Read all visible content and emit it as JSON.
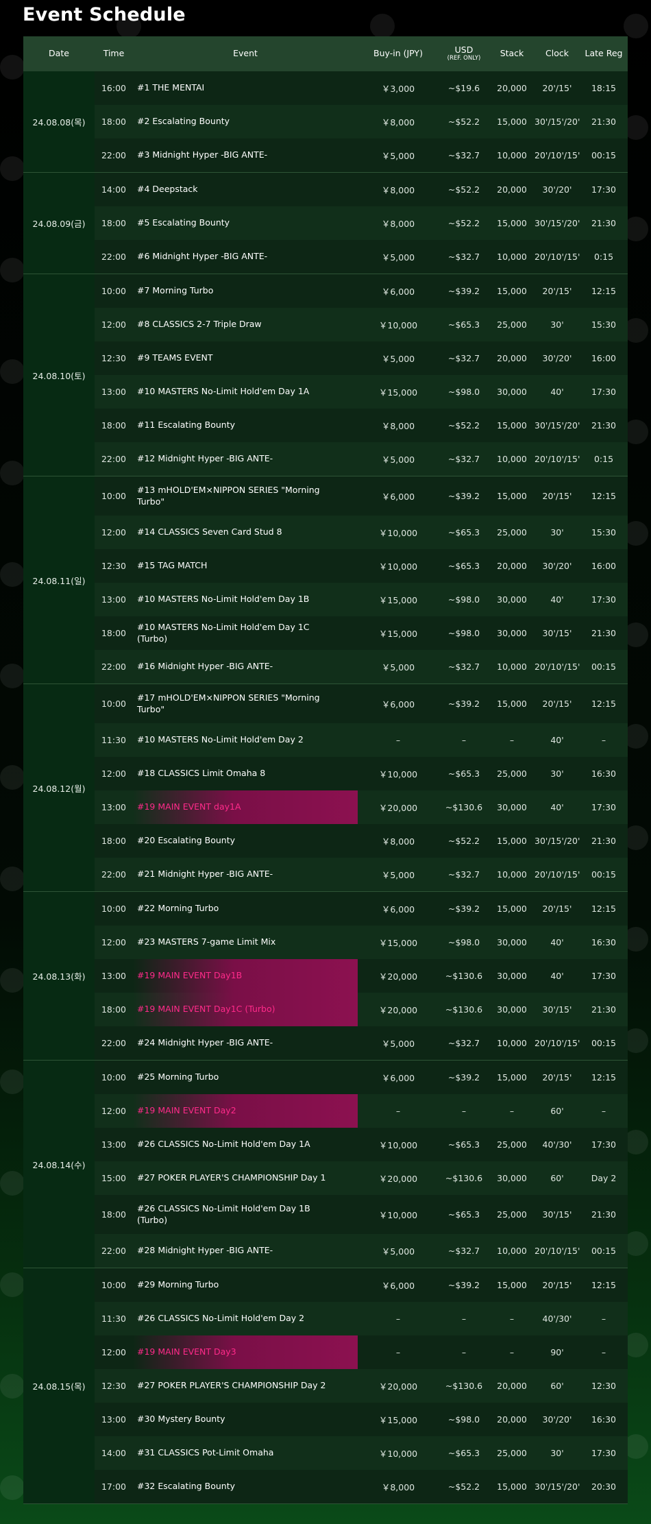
{
  "page_title": "Event Schedule",
  "columns": {
    "date": "Date",
    "time": "Time",
    "event": "Event",
    "buyin": "Buy-in (JPY)",
    "usd": "USD",
    "usd_note": "(REF. ONLY)",
    "stack": "Stack",
    "clock": "Clock",
    "late_reg": "Late Reg"
  },
  "days": [
    {
      "date": "24.08.08(목)",
      "events": [
        {
          "time": "16:00",
          "event": "#1 THE MENTAI",
          "buyin": "￥3,000",
          "usd": "~$19.6",
          "stack": "20,000",
          "clock": "20'/15'",
          "late": "18:15",
          "main": false,
          "tall": false
        },
        {
          "time": "18:00",
          "event": "#2 Escalating Bounty",
          "buyin": "￥8,000",
          "usd": "~$52.2",
          "stack": "15,000",
          "clock": "30'/15'/20'",
          "late": "21:30",
          "main": false,
          "tall": false
        },
        {
          "time": "22:00",
          "event": "#3 Midnight Hyper -BIG ANTE-",
          "buyin": "￥5,000",
          "usd": "~$32.7",
          "stack": "10,000",
          "clock": "20'/10'/15'",
          "late": "00:15",
          "main": false,
          "tall": false
        }
      ]
    },
    {
      "date": "24.08.09(금)",
      "events": [
        {
          "time": "14:00",
          "event": "#4 Deepstack",
          "buyin": "￥8,000",
          "usd": "~$52.2",
          "stack": "20,000",
          "clock": "30'/20'",
          "late": "17:30",
          "main": false,
          "tall": false
        },
        {
          "time": "18:00",
          "event": "#5 Escalating Bounty",
          "buyin": "￥8,000",
          "usd": "~$52.2",
          "stack": "15,000",
          "clock": "30'/15'/20'",
          "late": "21:30",
          "main": false,
          "tall": false
        },
        {
          "time": "22:00",
          "event": "#6 Midnight Hyper -BIG ANTE-",
          "buyin": "￥5,000",
          "usd": "~$32.7",
          "stack": "10,000",
          "clock": "20'/10'/15'",
          "late": "0:15",
          "main": false,
          "tall": false
        }
      ]
    },
    {
      "date": "24.08.10(토)",
      "events": [
        {
          "time": "10:00",
          "event": "#7 Morning Turbo",
          "buyin": "￥6,000",
          "usd": "~$39.2",
          "stack": "15,000",
          "clock": "20'/15'",
          "late": "12:15",
          "main": false,
          "tall": false
        },
        {
          "time": "12:00",
          "event": "#8 CLASSICS 2-7 Triple Draw",
          "buyin": "￥10,000",
          "usd": "~$65.3",
          "stack": "25,000",
          "clock": "30'",
          "late": "15:30",
          "main": false,
          "tall": false
        },
        {
          "time": "12:30",
          "event": "#9 TEAMS EVENT",
          "buyin": "￥5,000",
          "usd": "~$32.7",
          "stack": "20,000",
          "clock": "30'/20'",
          "late": "16:00",
          "main": false,
          "tall": false
        },
        {
          "time": "13:00",
          "event": "#10 MASTERS No-Limit Hold'em Day 1A",
          "buyin": "￥15,000",
          "usd": "~$98.0",
          "stack": "30,000",
          "clock": "40'",
          "late": "17:30",
          "main": false,
          "tall": false
        },
        {
          "time": "18:00",
          "event": "#11 Escalating Bounty",
          "buyin": "￥8,000",
          "usd": "~$52.2",
          "stack": "15,000",
          "clock": "30'/15'/20'",
          "late": "21:30",
          "main": false,
          "tall": false
        },
        {
          "time": "22:00",
          "event": "#12 Midnight Hyper -BIG ANTE-",
          "buyin": "￥5,000",
          "usd": "~$32.7",
          "stack": "10,000",
          "clock": "20'/10'/15'",
          "late": "0:15",
          "main": false,
          "tall": false
        }
      ]
    },
    {
      "date": "24.08.11(일)",
      "events": [
        {
          "time": "10:00",
          "event": "#13 mHOLD'EM×NIPPON SERIES \"Morning Turbo\"",
          "buyin": "￥6,000",
          "usd": "~$39.2",
          "stack": "15,000",
          "clock": "20'/15'",
          "late": "12:15",
          "main": false,
          "tall": true
        },
        {
          "time": "12:00",
          "event": "#14 CLASSICS Seven Card Stud 8",
          "buyin": "￥10,000",
          "usd": "~$65.3",
          "stack": "25,000",
          "clock": "30'",
          "late": "15:30",
          "main": false,
          "tall": false
        },
        {
          "time": "12:30",
          "event": "#15 TAG MATCH",
          "buyin": "￥10,000",
          "usd": "~$65.3",
          "stack": "20,000",
          "clock": "30'/20'",
          "late": "16:00",
          "main": false,
          "tall": false
        },
        {
          "time": "13:00",
          "event": "#10 MASTERS No-Limit Hold'em Day 1B",
          "buyin": "￥15,000",
          "usd": "~$98.0",
          "stack": "30,000",
          "clock": "40'",
          "late": "17:30",
          "main": false,
          "tall": false
        },
        {
          "time": "18:00",
          "event": "#10 MASTERS No-Limit Hold'em Day 1C (Turbo)",
          "buyin": "￥15,000",
          "usd": "~$98.0",
          "stack": "30,000",
          "clock": "30'/15'",
          "late": "21:30",
          "main": false,
          "tall": false
        },
        {
          "time": "22:00",
          "event": "#16 Midnight Hyper -BIG ANTE-",
          "buyin": "￥5,000",
          "usd": "~$32.7",
          "stack": "10,000",
          "clock": "20'/10'/15'",
          "late": "00:15",
          "main": false,
          "tall": false
        }
      ]
    },
    {
      "date": "24.08.12(월)",
      "events": [
        {
          "time": "10:00",
          "event": "#17 mHOLD'EM×NIPPON SERIES \"Morning Turbo\"",
          "buyin": "￥6,000",
          "usd": "~$39.2",
          "stack": "15,000",
          "clock": "20'/15'",
          "late": "12:15",
          "main": false,
          "tall": true
        },
        {
          "time": "11:30",
          "event": "#10 MASTERS No-Limit Hold'em Day 2",
          "buyin": "–",
          "usd": "–",
          "stack": "–",
          "clock": "40'",
          "late": "–",
          "main": false,
          "tall": false
        },
        {
          "time": "12:00",
          "event": "#18 CLASSICS Limit Omaha 8",
          "buyin": "￥10,000",
          "usd": "~$65.3",
          "stack": "25,000",
          "clock": "30'",
          "late": "16:30",
          "main": false,
          "tall": false
        },
        {
          "time": "13:00",
          "event": "#19 MAIN EVENT day1A",
          "buyin": "￥20,000",
          "usd": "~$130.6",
          "stack": "30,000",
          "clock": "40'",
          "late": "17:30",
          "main": true,
          "tall": false
        },
        {
          "time": "18:00",
          "event": "#20 Escalating Bounty",
          "buyin": "￥8,000",
          "usd": "~$52.2",
          "stack": "15,000",
          "clock": "30'/15'/20'",
          "late": "21:30",
          "main": false,
          "tall": false
        },
        {
          "time": "22:00",
          "event": "#21 Midnight Hyper -BIG ANTE-",
          "buyin": "￥5,000",
          "usd": "~$32.7",
          "stack": "10,000",
          "clock": "20'/10'/15'",
          "late": "00:15",
          "main": false,
          "tall": false
        }
      ]
    },
    {
      "date": "24.08.13(화)",
      "events": [
        {
          "time": "10:00",
          "event": "#22 Morning Turbo",
          "buyin": "￥6,000",
          "usd": "~$39.2",
          "stack": "15,000",
          "clock": "20'/15'",
          "late": "12:15",
          "main": false,
          "tall": false
        },
        {
          "time": "12:00",
          "event": "#23 MASTERS 7-game Limit Mix",
          "buyin": "￥15,000",
          "usd": "~$98.0",
          "stack": "30,000",
          "clock": "40'",
          "late": "16:30",
          "main": false,
          "tall": false
        },
        {
          "time": "13:00",
          "event": "#19 MAIN EVENT Day1B",
          "buyin": "￥20,000",
          "usd": "~$130.6",
          "stack": "30,000",
          "clock": "40'",
          "late": "17:30",
          "main": true,
          "tall": false
        },
        {
          "time": "18:00",
          "event": "#19 MAIN EVENT Day1C (Turbo)",
          "buyin": "￥20,000",
          "usd": "~$130.6",
          "stack": "30,000",
          "clock": "30'/15'",
          "late": "21:30",
          "main": true,
          "tall": false
        },
        {
          "time": "22:00",
          "event": "#24 Midnight Hyper -BIG ANTE-",
          "buyin": "￥5,000",
          "usd": "~$32.7",
          "stack": "10,000",
          "clock": "20'/10'/15'",
          "late": "00:15",
          "main": false,
          "tall": false
        }
      ]
    },
    {
      "date": "24.08.14(수)",
      "events": [
        {
          "time": "10:00",
          "event": "#25 Morning Turbo",
          "buyin": "￥6,000",
          "usd": "~$39.2",
          "stack": "15,000",
          "clock": "20'/15'",
          "late": "12:15",
          "main": false,
          "tall": false
        },
        {
          "time": "12:00",
          "event": "#19 MAIN EVENT Day2",
          "buyin": "–",
          "usd": "–",
          "stack": "–",
          "clock": "60'",
          "late": "–",
          "main": true,
          "tall": false
        },
        {
          "time": "13:00",
          "event": "#26 CLASSICS No-Limit Hold'em Day 1A",
          "buyin": "￥10,000",
          "usd": "~$65.3",
          "stack": "25,000",
          "clock": "40'/30'",
          "late": "17:30",
          "main": false,
          "tall": false
        },
        {
          "time": "15:00",
          "event": "#27 POKER PLAYER'S CHAMPIONSHIP Day 1",
          "buyin": "￥20,000",
          "usd": "~$130.6",
          "stack": "30,000",
          "clock": "60'",
          "late": "Day 2",
          "main": false,
          "tall": false
        },
        {
          "time": "18:00",
          "event": "#26 CLASSICS No-Limit Hold'em Day 1B (Turbo)",
          "buyin": "￥10,000",
          "usd": "~$65.3",
          "stack": "25,000",
          "clock": "30'/15'",
          "late": "21:30",
          "main": false,
          "tall": true
        },
        {
          "time": "22:00",
          "event": "#28 Midnight Hyper -BIG ANTE-",
          "buyin": "￥5,000",
          "usd": "~$32.7",
          "stack": "10,000",
          "clock": "20'/10'/15'",
          "late": "00:15",
          "main": false,
          "tall": false
        }
      ]
    },
    {
      "date": "24.08.15(목)",
      "events": [
        {
          "time": "10:00",
          "event": "#29 Morning Turbo",
          "buyin": "￥6,000",
          "usd": "~$39.2",
          "stack": "15,000",
          "clock": "20'/15'",
          "late": "12:15",
          "main": false,
          "tall": false
        },
        {
          "time": "11:30",
          "event": "#26 CLASSICS No-Limit Hold'em Day 2",
          "buyin": "–",
          "usd": "–",
          "stack": "–",
          "clock": "40'/30'",
          "late": "–",
          "main": false,
          "tall": false
        },
        {
          "time": "12:00",
          "event": "#19 MAIN EVENT Day3",
          "buyin": "–",
          "usd": "–",
          "stack": "–",
          "clock": "90'",
          "late": "–",
          "main": true,
          "tall": false
        },
        {
          "time": "12:30",
          "event": "#27 POKER PLAYER'S CHAMPIONSHIP Day 2",
          "buyin": "￥20,000",
          "usd": "~$130.6",
          "stack": "20,000",
          "clock": "60'",
          "late": "12:30",
          "main": false,
          "tall": false
        },
        {
          "time": "13:00",
          "event": "#30 Mystery Bounty",
          "buyin": "￥15,000",
          "usd": "~$98.0",
          "stack": "20,000",
          "clock": "30'/20'",
          "late": "16:30",
          "main": false,
          "tall": false
        },
        {
          "time": "14:00",
          "event": "#31 CLASSICS Pot-Limit Omaha",
          "buyin": "￥10,000",
          "usd": "~$65.3",
          "stack": "25,000",
          "clock": "30'",
          "late": "17:30",
          "main": false,
          "tall": false
        },
        {
          "time": "17:00",
          "event": "#32 Escalating Bounty",
          "buyin": "￥8,000",
          "usd": "~$52.2",
          "stack": "15,000",
          "clock": "30'/15'/20'",
          "late": "20:30",
          "main": false,
          "tall": false
        }
      ]
    }
  ],
  "colors": {
    "header_bg": "#24452d",
    "row_odd": "#0d2615",
    "row_even": "#112f1a",
    "date_bg": "#072a13",
    "main_event_text": "#ff2a8a",
    "main_event_bg": "#8c1150"
  },
  "icons": [
    "poker-club-logo"
  ]
}
